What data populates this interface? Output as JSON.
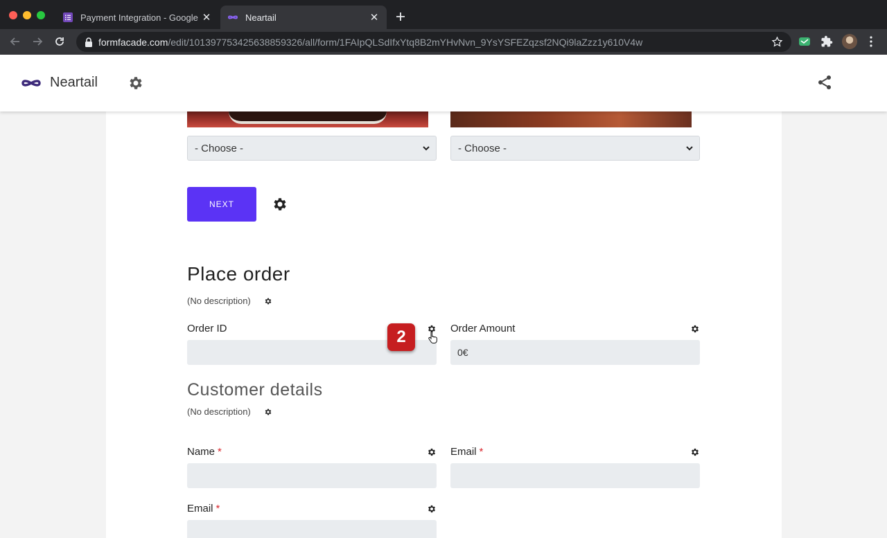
{
  "browser": {
    "tabs": [
      {
        "title": "Payment Integration - Google F"
      },
      {
        "title": "Neartail"
      }
    ],
    "url_host": "formfacade.com",
    "url_path": "/edit/101397753425638859326/all/form/1FAIpQLSdIfxYtq8B2mYHvNvn_9YsYSFEZqzsf2NQi9laZzz1y610V4w"
  },
  "header": {
    "brand": "Neartail"
  },
  "form": {
    "selects": [
      {
        "value": "- Choose -"
      },
      {
        "value": "- Choose -"
      }
    ],
    "next_label": "NEXT",
    "place_order": {
      "title": "Place order",
      "description": "(No description)",
      "fields": {
        "order_id": {
          "label": "Order ID",
          "value": ""
        },
        "order_amount": {
          "label": "Order Amount",
          "value": "0€"
        }
      }
    },
    "customer": {
      "title": "Customer details",
      "description": "(No description)",
      "fields": {
        "name": {
          "label": "Name",
          "required": "*"
        },
        "email_1": {
          "label": "Email",
          "required": "*"
        },
        "email_2": {
          "label": "Email",
          "required": "*"
        }
      }
    },
    "step_badge": "2"
  },
  "colors": {
    "accent": "#5b33f5",
    "required": "#d9262c",
    "badge": "#c61e20"
  }
}
